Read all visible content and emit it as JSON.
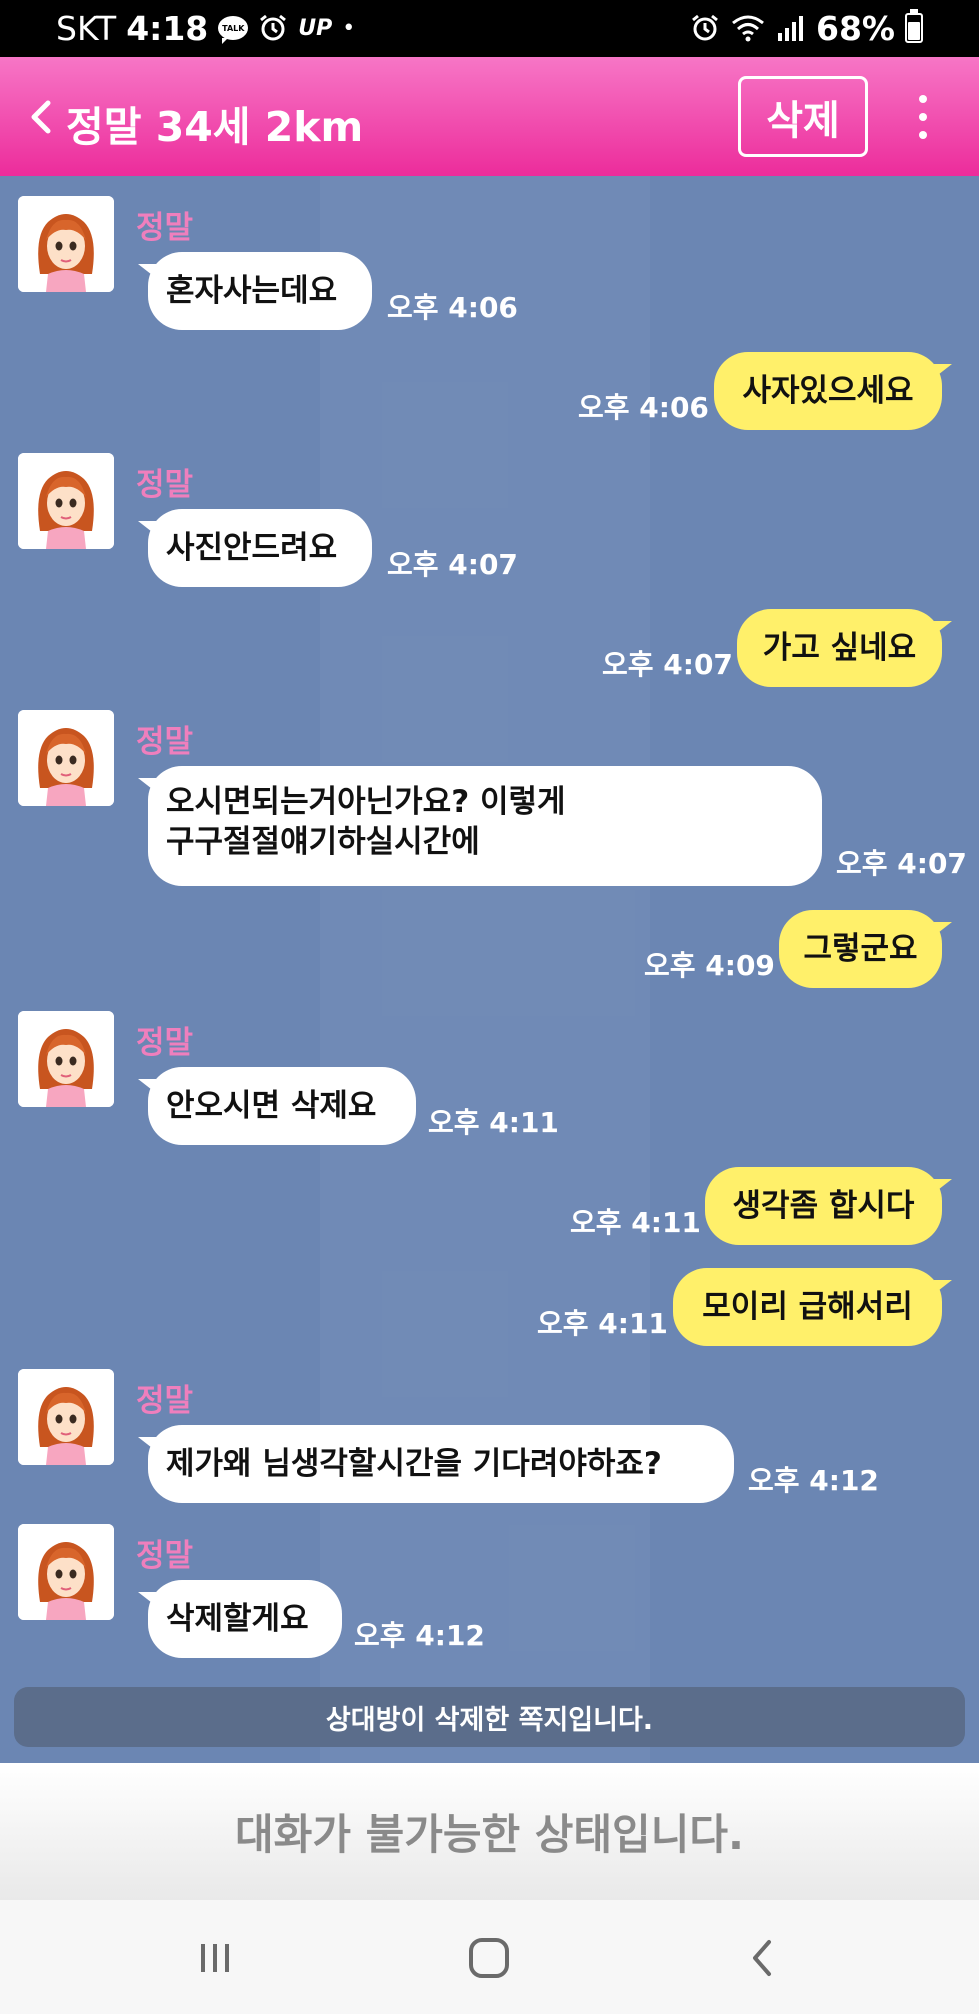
{
  "status_bar": {
    "carrier": "SKT",
    "time": "4:18",
    "talk_icon_label": "TALK",
    "up_label": "UP",
    "dot": "•",
    "battery": "68%",
    "battery_level": 0.68,
    "icons": [
      "talk-icon",
      "alarm-icon",
      "up-icon",
      "alarm-icon",
      "wifi-icon",
      "signal-icon",
      "battery-icon"
    ]
  },
  "header": {
    "title": "정말 34세 2km",
    "delete_label": "삭제",
    "colors": {
      "gradient_top": "#f776c6",
      "gradient_bottom": "#ec2c9b"
    }
  },
  "chat": {
    "background": "#6b86b3",
    "bubble_in_color": "#ffffff",
    "bubble_out_color": "#fff06a",
    "sender_color": "#ef7fbd",
    "messages": [
      {
        "side": "in",
        "sender": "정말",
        "text": "혼자사는데요",
        "time": "오후 4:06"
      },
      {
        "side": "out",
        "text": "사자있으세요",
        "time": "오후 4:06"
      },
      {
        "side": "in",
        "sender": "정말",
        "text": "사진안드려요",
        "time": "오후 4:07"
      },
      {
        "side": "out",
        "text": "가고 싶네요",
        "time": "오후 4:07"
      },
      {
        "side": "in",
        "sender": "정말",
        "text_line1": "오시면되는거아닌가요? 이렇게",
        "text_line2": "구구절절얘기하실시간에",
        "time": "오후 4:07"
      },
      {
        "side": "out",
        "text": "그렇군요",
        "time": "오후 4:09"
      },
      {
        "side": "in",
        "sender": "정말",
        "text": "안오시면 삭제요",
        "time": "오후 4:11"
      },
      {
        "side": "out",
        "text": "생각좀 합시다",
        "time": "오후 4:11"
      },
      {
        "side": "out",
        "text": "모이리 급해서리",
        "time": "오후 4:11"
      },
      {
        "side": "in",
        "sender": "정말",
        "text": "제가왜 님생각할시간을 기다려야하죠?",
        "time": "오후 4:12"
      },
      {
        "side": "in",
        "sender": "정말",
        "text": "삭제할게요",
        "time": "오후 4:12"
      }
    ],
    "notice": "상대방이 삭제한 쪽지입니다."
  },
  "input_bar": {
    "disabled_text": "대화가 불가능한 상태입니다."
  },
  "nav_bar": {
    "icons": [
      "recent-apps-icon",
      "home-icon",
      "back-icon"
    ]
  }
}
